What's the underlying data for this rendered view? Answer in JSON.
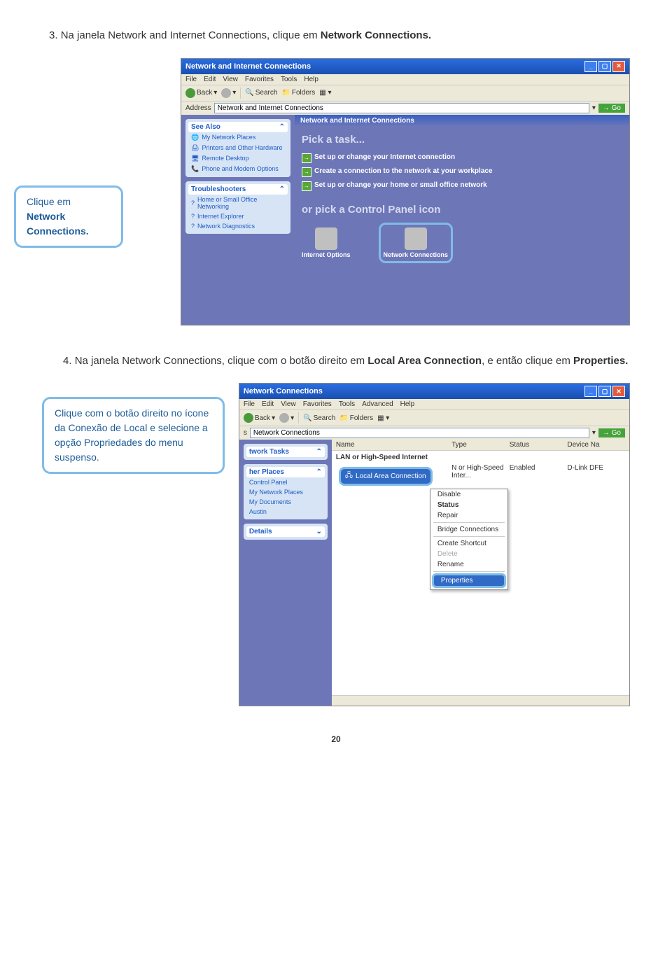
{
  "step3": {
    "num": "3.",
    "text_a": "Na janela Network and Internet Connections, clique em ",
    "text_b": "Network Connections."
  },
  "callout1": {
    "line1": "Clique em",
    "line2": "Network",
    "line3": "Connections."
  },
  "shot1": {
    "title": "Network and Internet Connections",
    "menu": [
      "File",
      "Edit",
      "View",
      "Favorites",
      "Tools",
      "Help"
    ],
    "back": "Back",
    "search": "Search",
    "folders": "Folders",
    "addr_label": "Address",
    "addr_value": "Network and Internet Connections",
    "go": "Go",
    "see_also": "See Also",
    "see_items": [
      "My Network Places",
      "Printers and Other Hardware",
      "Remote Desktop",
      "Phone and Modem Options"
    ],
    "trouble": "Troubleshooters",
    "trouble_items": [
      "Home or Small Office Networking",
      "Internet Explorer",
      "Network Diagnostics"
    ],
    "crumb": "Network and Internet Connections",
    "pick": "Pick a task...",
    "tasks": [
      "Set up or change your Internet connection",
      "Create a connection to the network at your workplace",
      "Set up or change your home or small office network"
    ],
    "orpick": "or pick a Control Panel icon",
    "icon1": "Internet Options",
    "icon2": "Network Connections"
  },
  "step4": {
    "num": "4.",
    "text_a": "Na janela Network Connections, clique com o botão direito em ",
    "text_b": "Local Area Connection",
    "text_c": ", e então clique em ",
    "text_d": "Properties."
  },
  "callout2": "Clique com o botão direito no ícone da Conexão de Local e selecione a opção Propriedades do menu suspenso.",
  "shot2": {
    "title": "Network Connections",
    "menu": [
      "File",
      "Edit",
      "View",
      "Favorites",
      "Tools",
      "Advanced",
      "Help"
    ],
    "back": "Back",
    "search": "Search",
    "folders": "Folders",
    "addr_value": "Network Connections",
    "go": "Go",
    "nettasks": "twork Tasks",
    "other": "her Places",
    "other_items": [
      "Control Panel",
      "My Network Places",
      "My Documents",
      "Austin"
    ],
    "details": "Details",
    "cols": [
      "Name",
      "Type",
      "Status",
      "Device Na"
    ],
    "group": "LAN or High-Speed Internet",
    "conn": "Local Area Connection",
    "type": "N or High-Speed Inter...",
    "status": "Enabled",
    "device": "D-Link DFE",
    "ctx": [
      "Disable",
      "Status",
      "Repair",
      "Bridge Connections",
      "Create Shortcut",
      "Delete",
      "Rename",
      "Properties"
    ]
  },
  "page": "20"
}
